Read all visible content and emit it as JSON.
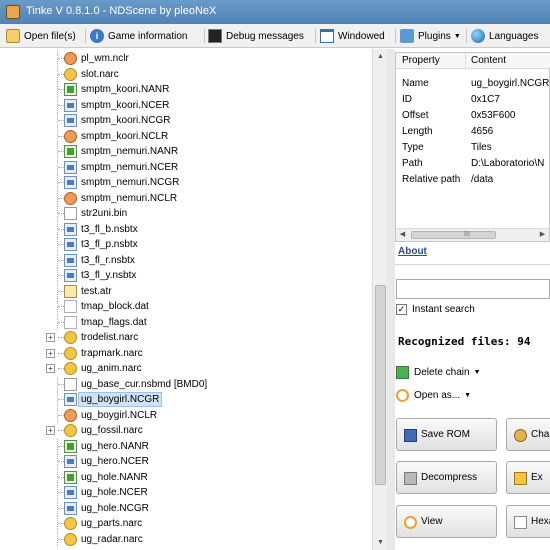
{
  "window": {
    "title": "Tinke V 0.8.1.0 - NDScene by pleoNeX"
  },
  "toolbar": {
    "open_files": "Open file(s)",
    "game_information": "Game information",
    "debug_messages": "Debug messages",
    "windowed": "Windowed",
    "plugins": "Plugins",
    "languages": "Languages"
  },
  "tree": {
    "items": [
      {
        "label": "pl_wm.nclr",
        "icon": "palette-icon",
        "expander": ""
      },
      {
        "label": "slot.narc",
        "icon": "narc-icon",
        "expander": ""
      },
      {
        "label": "smptm_koori.NANR",
        "icon": "animation-icon",
        "expander": ""
      },
      {
        "label": "smptm_koori.NCER",
        "icon": "texture-icon",
        "expander": ""
      },
      {
        "label": "smptm_koori.NCGR",
        "icon": "texture-icon",
        "expander": ""
      },
      {
        "label": "smptm_koori.NCLR",
        "icon": "palette-icon",
        "expander": ""
      },
      {
        "label": "smptm_nemuri.NANR",
        "icon": "animation-icon",
        "expander": ""
      },
      {
        "label": "smptm_nemuri.NCER",
        "icon": "texture-icon",
        "expander": ""
      },
      {
        "label": "smptm_nemuri.NCGR",
        "icon": "texture-icon",
        "expander": ""
      },
      {
        "label": "smptm_nemuri.NCLR",
        "icon": "palette-icon",
        "expander": ""
      },
      {
        "label": "str2uni.bin",
        "icon": "file-icon",
        "expander": ""
      },
      {
        "label": "t3_fl_b.nsbtx",
        "icon": "texture-icon",
        "expander": ""
      },
      {
        "label": "t3_fl_p.nsbtx",
        "icon": "texture-icon",
        "expander": ""
      },
      {
        "label": "t3_fl_r.nsbtx",
        "icon": "texture-icon",
        "expander": ""
      },
      {
        "label": "t3_fl_y.nsbtx",
        "icon": "texture-icon",
        "expander": ""
      },
      {
        "label": "test.atr",
        "icon": "font-icon",
        "expander": ""
      },
      {
        "label": "tmap_block.dat",
        "icon": "data-icon",
        "expander": ""
      },
      {
        "label": "tmap_flags.dat",
        "icon": "data-icon",
        "expander": ""
      },
      {
        "label": "trodelist.narc",
        "icon": "narc-icon",
        "expander": "+"
      },
      {
        "label": "trapmark.narc",
        "icon": "narc-icon",
        "expander": "+"
      },
      {
        "label": "ug_anim.narc",
        "icon": "narc-icon",
        "expander": "+"
      },
      {
        "label": "ug_base_cur.nsbmd [BMD0]",
        "icon": "file-icon",
        "expander": ""
      },
      {
        "label": "ug_boygirl.NCGR",
        "icon": "texture-icon",
        "expander": "",
        "selected": true
      },
      {
        "label": "ug_boygirl.NCLR",
        "icon": "palette-icon",
        "expander": ""
      },
      {
        "label": "ug_fossil.narc",
        "icon": "narc-icon",
        "expander": "+"
      },
      {
        "label": "ug_hero.NANR",
        "icon": "animation-icon",
        "expander": ""
      },
      {
        "label": "ug_hero.NCER",
        "icon": "texture-icon",
        "expander": ""
      },
      {
        "label": "ug_hole.NANR",
        "icon": "animation-icon",
        "expander": ""
      },
      {
        "label": "ug_hole.NCER",
        "icon": "texture-icon",
        "expander": ""
      },
      {
        "label": "ug_hole.NCGR",
        "icon": "texture-icon",
        "expander": ""
      },
      {
        "label": "ug_parts.narc",
        "icon": "narc-icon",
        "expander": ""
      },
      {
        "label": "ug_radar.narc",
        "icon": "narc-icon",
        "expander": ""
      }
    ]
  },
  "properties": {
    "header": {
      "property": "Property",
      "content": "Content"
    },
    "rows": [
      {
        "property": "Name",
        "content": "ug_boygirl.NCGR"
      },
      {
        "property": "ID",
        "content": "0x1C7"
      },
      {
        "property": "Offset",
        "content": "0x53F600"
      },
      {
        "property": "Length",
        "content": "4656"
      },
      {
        "property": "Type",
        "content": "Tiles"
      },
      {
        "property": "Path",
        "content": "D:\\Laboratorio\\N"
      },
      {
        "property": "Relative path",
        "content": "/data"
      }
    ],
    "hscroll_grip": "III"
  },
  "about": "About",
  "search": {
    "value": "",
    "instant_label": "Instant search",
    "instant_checked": true
  },
  "recognized": "Recognized files: 94",
  "chain": {
    "delete_chain": "Delete chain",
    "open_as": "Open as..."
  },
  "buttons": {
    "save_rom": "Save ROM",
    "change": "Cha",
    "decompress": "Decompress",
    "extract": "Ex",
    "view": "View",
    "hexadecimal": "Hexa"
  },
  "scroll": {
    "arrow_up": "▲",
    "arrow_down": "▼",
    "arrow_left": "◀",
    "arrow_right": "▶"
  }
}
